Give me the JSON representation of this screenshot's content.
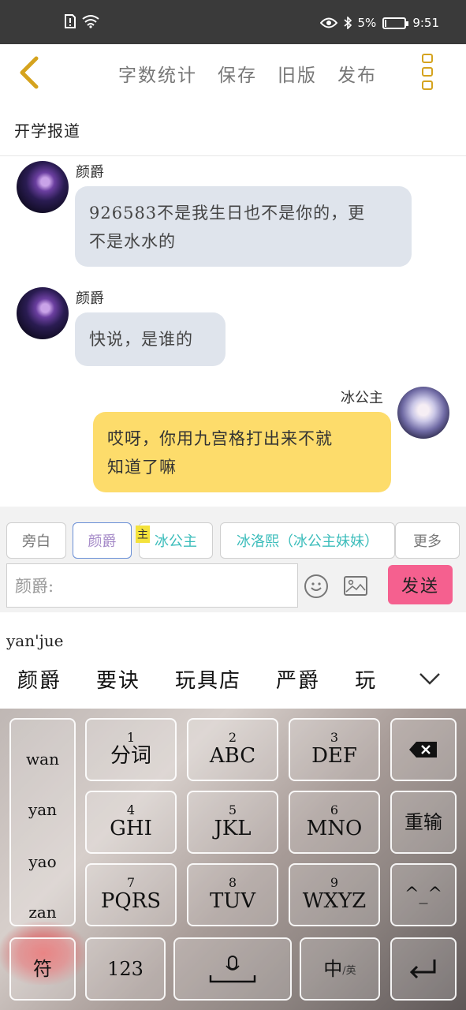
{
  "status_bar": {
    "battery_text": "5%",
    "battery_level": 0.05,
    "time": "9:51"
  },
  "top_nav": {
    "links": [
      "字数统计",
      "保存",
      "旧版",
      "发布"
    ]
  },
  "document": {
    "title": "开学报道"
  },
  "messages": [
    {
      "sender": "颜爵",
      "text_line1": "926583不是我生日也不是你的，更",
      "text_line2": "不是水水的",
      "side": "left"
    },
    {
      "sender": "颜爵",
      "text_line1": "快说，是谁的",
      "side": "left"
    },
    {
      "sender": "冰公主",
      "text_line1": "哎呀，你用九宫格打出来不就",
      "text_line2": "知道了嘛",
      "side": "right"
    }
  ],
  "roles": {
    "narrator": "旁白",
    "role1": "颜爵",
    "owner_badge": "主",
    "role2": "冰公主",
    "role3": "冰洛熙（冰公主妹妹）",
    "more": "更多"
  },
  "composer": {
    "input_value": "颜爵:",
    "send_label": "发送"
  },
  "ime": {
    "pinyin": "yan'jue",
    "candidates": [
      "颜爵",
      "要诀",
      "玩具店",
      "严爵",
      "玩"
    ],
    "side_syllables": [
      "wan",
      "yan",
      "yao",
      "zan"
    ],
    "keys": [
      {
        "num": "1",
        "letters": "分词"
      },
      {
        "num": "2",
        "letters": "ABC"
      },
      {
        "num": "3",
        "letters": "DEF"
      },
      {
        "num": "4",
        "letters": "GHI"
      },
      {
        "num": "5",
        "letters": "JKL"
      },
      {
        "num": "6",
        "letters": "MNO"
      },
      {
        "num": "7",
        "letters": "PQRS"
      },
      {
        "num": "8",
        "letters": "TUV"
      },
      {
        "num": "9",
        "letters": "WXYZ"
      }
    ],
    "reinput_label": "重输",
    "emoticon_label": "^_^",
    "symbol_label": "符",
    "numeric_label": "123",
    "lang_main": "中",
    "lang_sub": "/英"
  }
}
